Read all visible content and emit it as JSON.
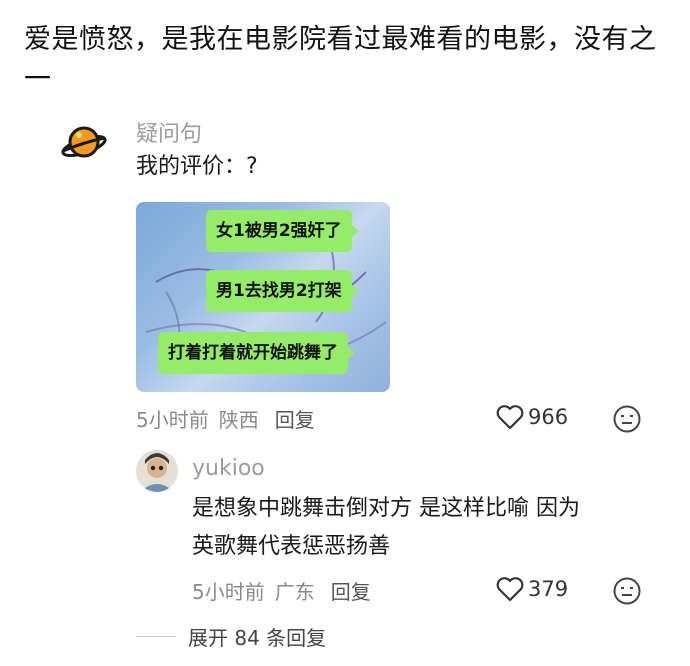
{
  "post": {
    "text": "爱是愤怒，是我在电影院看过最难看的电影，没有之一"
  },
  "comment1": {
    "username": "疑问句",
    "text": "我的评价：?",
    "image_bubbles": [
      "女1被男2强奸了",
      "男1去找男2打架",
      "打着打着就开始跳舞了"
    ],
    "time": "5小时前",
    "location": "陕西",
    "reply_label": "回复",
    "likes": "966"
  },
  "comment2": {
    "username": "yukioo",
    "text_line1": "是想象中跳舞击倒对方 是这样比喻 因为",
    "text_line2": "英歌舞代表惩恶扬善",
    "time": "5小时前",
    "location": "广东",
    "reply_label": "回复",
    "likes": "379"
  },
  "expand": {
    "label": "展开 84 条回复"
  },
  "colors": {
    "bubble_green": "#95ec69",
    "planet_orange": "#f39a1e",
    "meta_gray": "#8a8a8a"
  },
  "icons": [
    "planet-avatar",
    "heart-icon",
    "emoji-face-icon",
    "user-avatar"
  ]
}
